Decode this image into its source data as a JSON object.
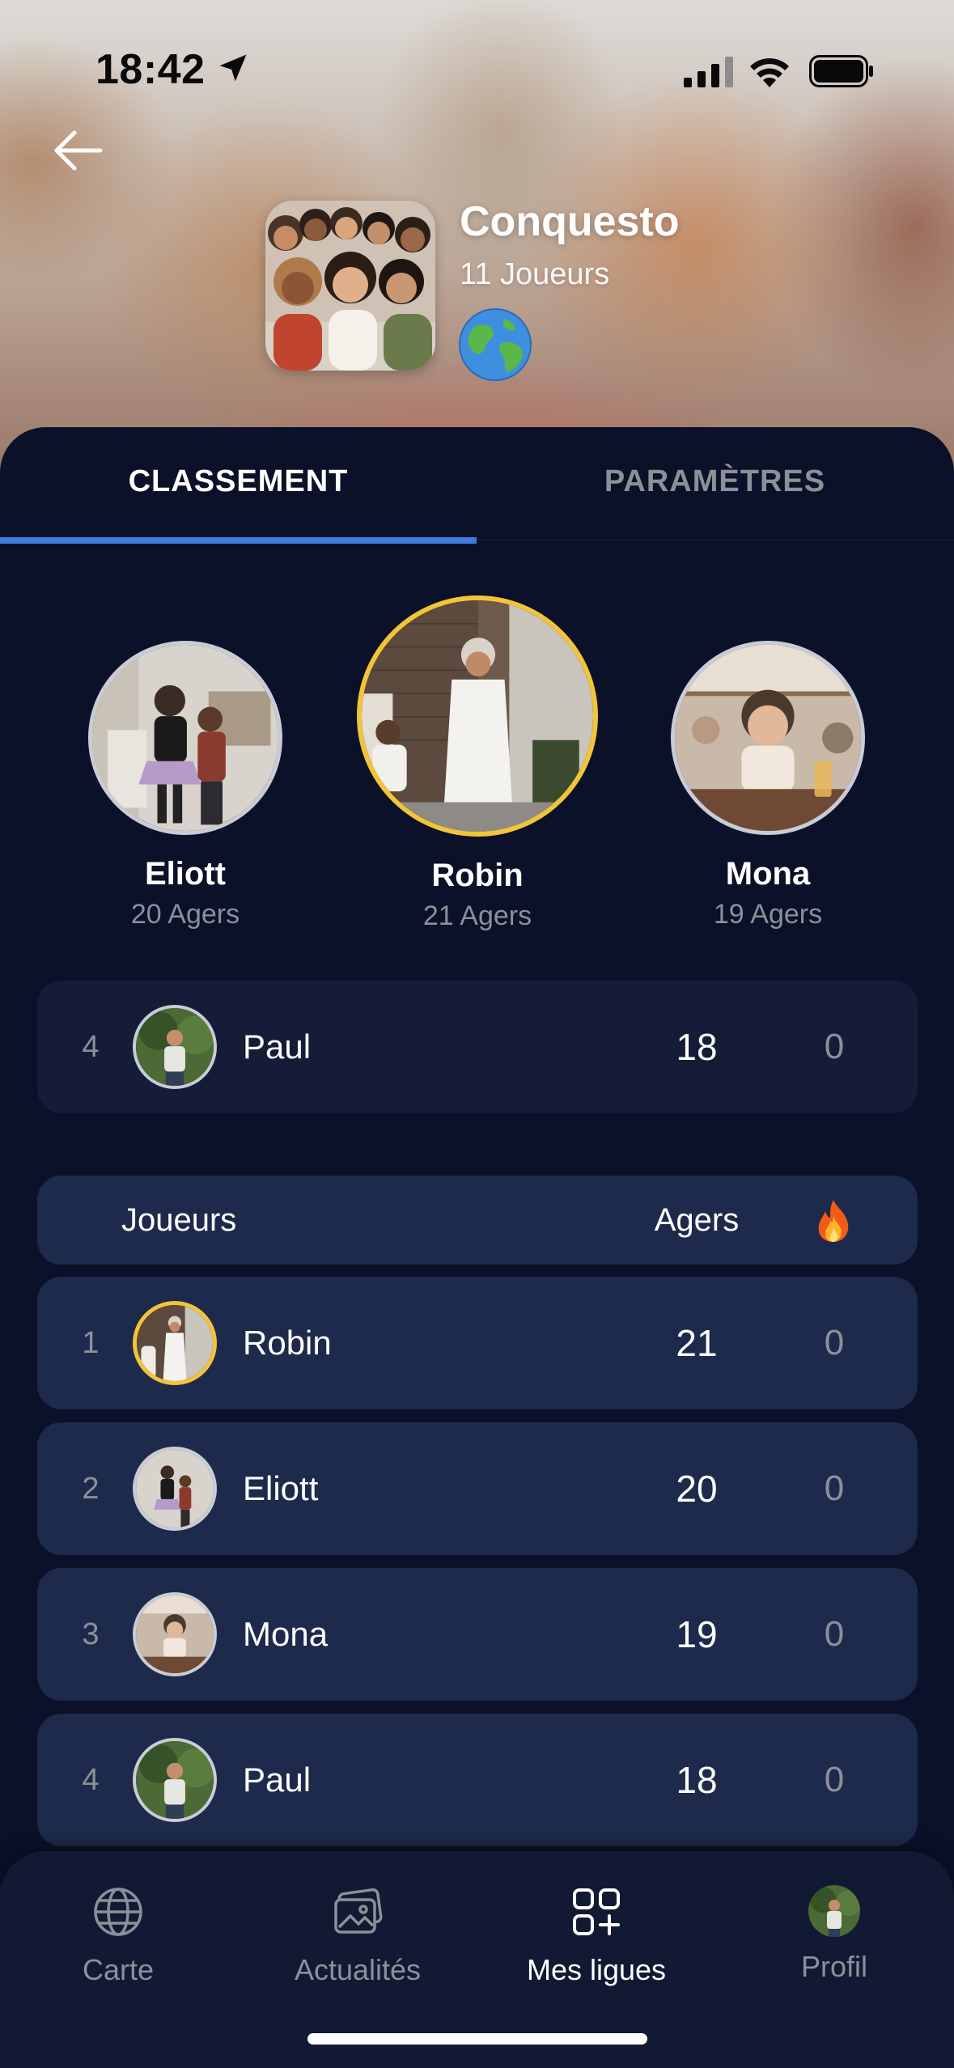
{
  "status_bar": {
    "time": "18:42"
  },
  "league": {
    "name": "Conquesto",
    "players_count": "11 Joueurs"
  },
  "tabs": [
    {
      "label": "CLASSEMENT",
      "active": true
    },
    {
      "label": "PARAMÈTRES",
      "active": false
    }
  ],
  "podium": [
    {
      "name": "Eliott",
      "score": "20 Agers",
      "place": 2
    },
    {
      "name": "Robin",
      "score": "21 Agers",
      "place": 1
    },
    {
      "name": "Mona",
      "score": "19 Agers",
      "place": 3
    }
  ],
  "my_rank": {
    "rank": "4",
    "name": "Paul",
    "agers": "18",
    "streak": "0"
  },
  "table": {
    "header": {
      "players": "Joueurs",
      "agers": "Agers",
      "streak_icon": "fire-icon"
    },
    "rows": [
      {
        "rank": "1",
        "name": "Robin",
        "agers": "21",
        "streak": "0",
        "highlight": "gold"
      },
      {
        "rank": "2",
        "name": "Eliott",
        "agers": "20",
        "streak": "0"
      },
      {
        "rank": "3",
        "name": "Mona",
        "agers": "19",
        "streak": "0"
      },
      {
        "rank": "4",
        "name": "Paul",
        "agers": "18",
        "streak": "0"
      }
    ]
  },
  "bottom_nav": [
    {
      "label": "Carte",
      "icon": "globe-icon",
      "active": false
    },
    {
      "label": "Actualités",
      "icon": "images-icon",
      "active": false
    },
    {
      "label": "Mes ligues",
      "icon": "grid-plus-icon",
      "active": true
    },
    {
      "label": "Profil",
      "icon": "avatar",
      "active": false
    }
  ],
  "colors": {
    "background": "#0b1128",
    "row": "#1e2a4b",
    "accent": "#3d7bdc",
    "gold": "#f2c437",
    "muted": "#8d8f99"
  }
}
